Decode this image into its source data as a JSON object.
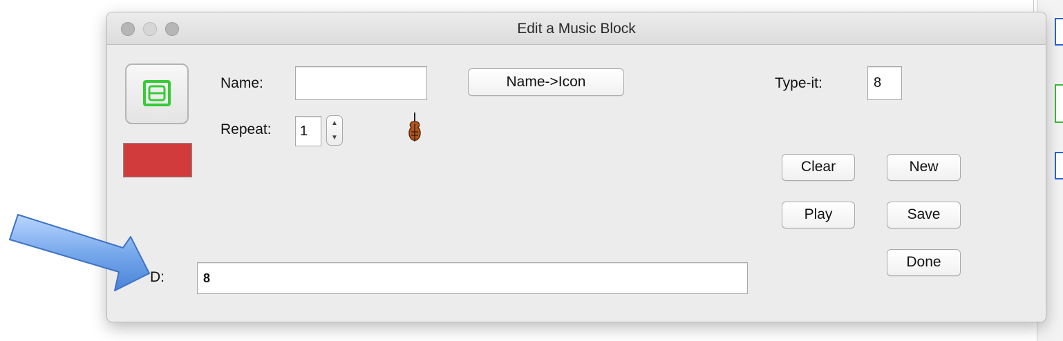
{
  "dialog": {
    "title": "Edit a Music Block",
    "name_label": "Name:",
    "name_value": "",
    "name_to_icon_label": "Name->Icon",
    "type_it_label": "Type-it:",
    "type_it_value": "8",
    "repeat_label": "Repeat:",
    "repeat_value": "1",
    "clear_label": "Clear",
    "new_label": "New",
    "play_label": "Play",
    "save_label": "Save",
    "done_label": "Done",
    "d_label": "D:",
    "d_value": "8",
    "color_swatch": "#d23b3b",
    "instrument_icon": "violin-icon",
    "block_icon": "music-block-icon",
    "block_icon_color": "#35cc35"
  }
}
